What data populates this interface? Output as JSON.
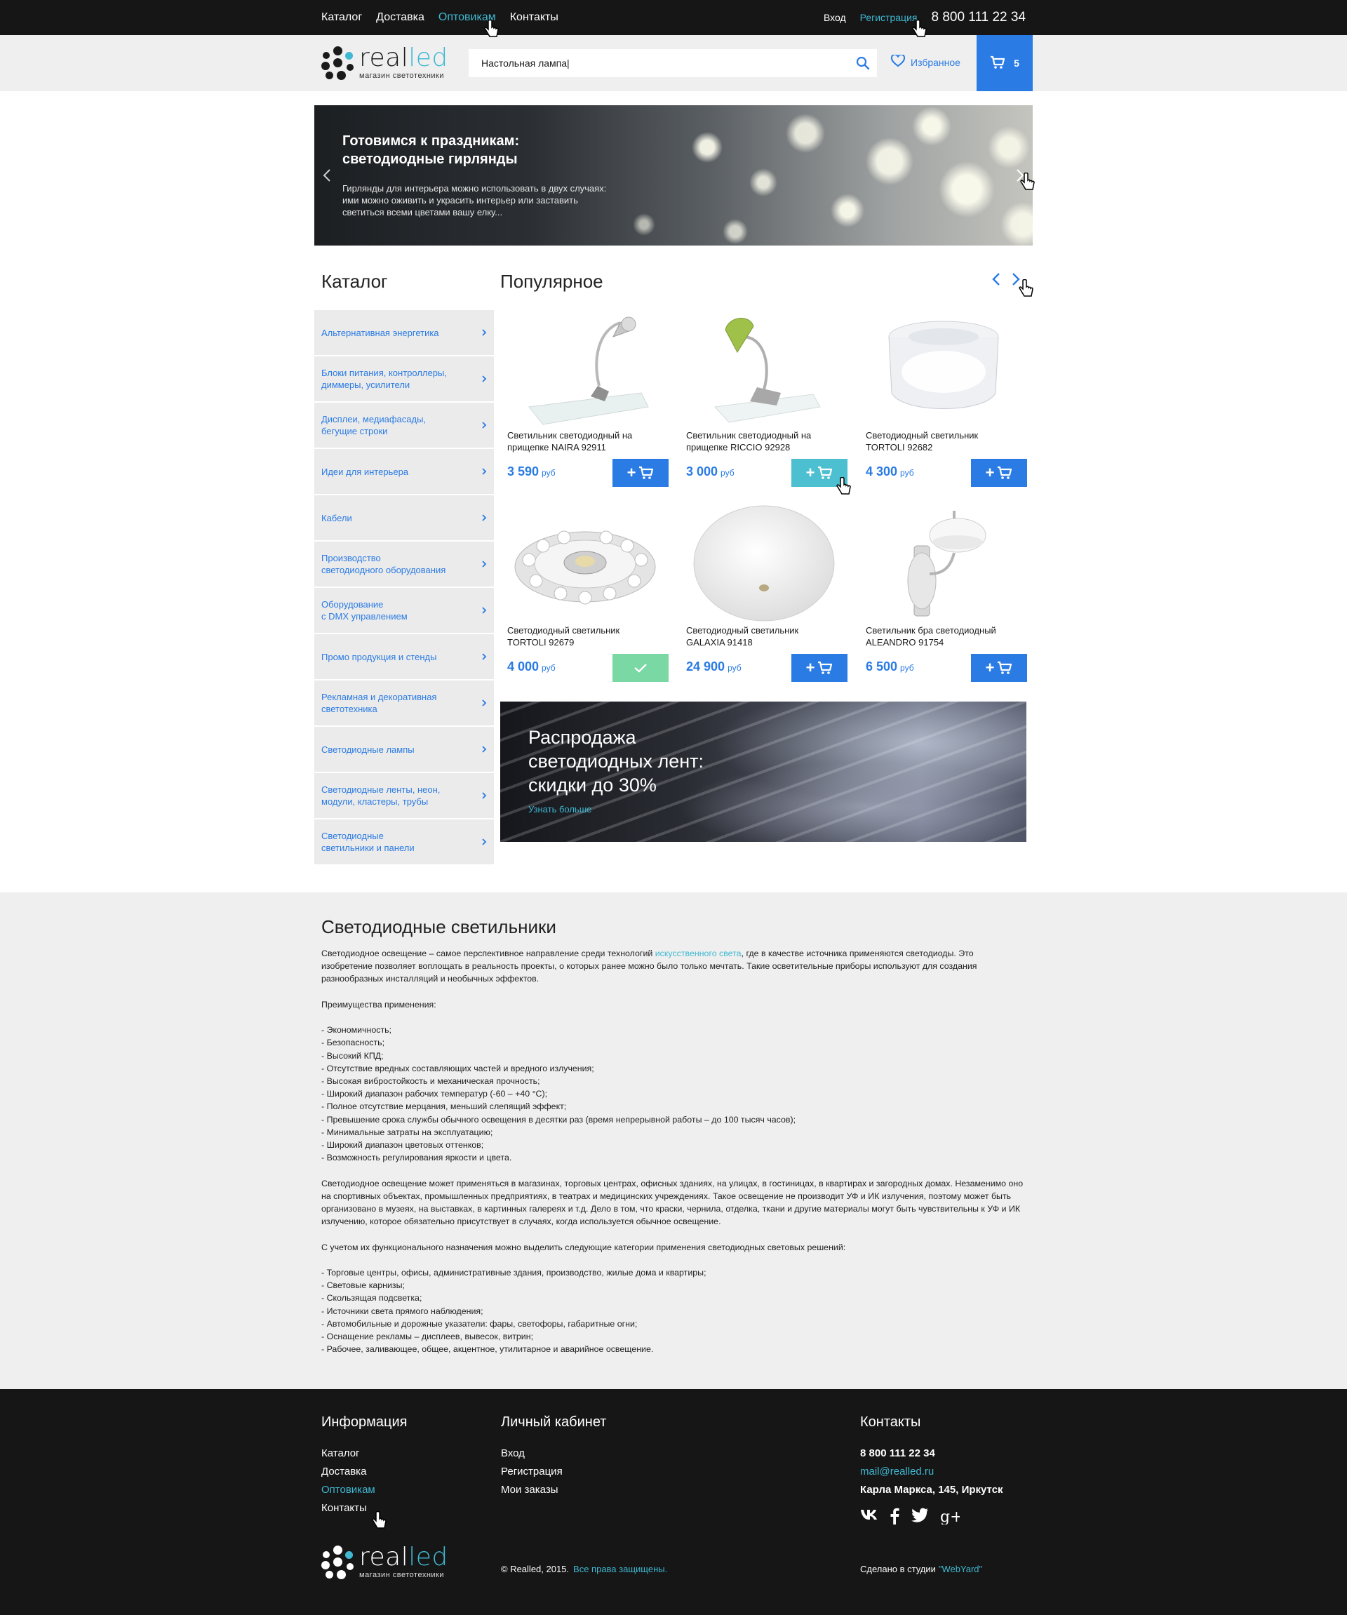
{
  "colors": {
    "accent_blue": "#2a7be4",
    "accent_cyan": "#3fb8d2",
    "dark": "#161616",
    "light_bg": "#efefef",
    "success": "#79d8a3"
  },
  "topbar": {
    "nav": [
      "Каталог",
      "Доставка",
      "Оптовикам",
      "Контакты"
    ],
    "active_nav": "Оптовикам",
    "login": "Вход",
    "register": "Регистрация",
    "phone": "8 800 111 22 34"
  },
  "header": {
    "logo": {
      "name_a": "real",
      "name_b": "led",
      "tagline": "магазин светотехники"
    },
    "search": {
      "value": "Настольная лампа|",
      "icon": "search-icon"
    },
    "favorites": {
      "label": "Избранное",
      "icon": "heart-icon"
    },
    "cart": {
      "count": "5",
      "icon": "cart-icon"
    }
  },
  "hero": {
    "title": "Готовимся к праздникам: светодиодные гирлянды",
    "text": "Гирлянды для интерьера можно использовать в двух случаях: ими можно оживить и украсить интерьер или заставить светиться всеми цветами вашу елку..."
  },
  "catalog": {
    "title": "Каталог",
    "items": [
      "Альтернативная энергетика",
      "Блоки питания, контроллеры,\nдиммеры, усилители",
      "Дисплеи, медиафасады,\nбегущие строки",
      "Идеи для интерьера",
      "Кабели",
      "Производство\nсветодиодного оборудования",
      "Оборудование\nс DMX управлением",
      "Промо продукция и стенды",
      "Рекламная и декоративная\nсветотехника",
      "Светодиодные лампы",
      "Светодиодные ленты, неон,\nмодули, кластеры, трубы",
      "Светодиодные\nсветильники и панели"
    ]
  },
  "popular": {
    "title": "Популярное",
    "products": [
      {
        "name": "Светильник светодиодный на\nприщепке NAIRA 92911",
        "price": "3 590",
        "currency": "руб",
        "state": "normal"
      },
      {
        "name": "Светильник светодиодный на\nприщепке RICCIO 92928",
        "price": "3 000",
        "currency": "руб",
        "state": "hover"
      },
      {
        "name": "Светодиодный светильник\nTORTOLI 92682",
        "price": "4 300",
        "currency": "руб",
        "state": "normal"
      },
      {
        "name": "Светодиодный светильник\nTORTOLI 92679",
        "price": "4 000",
        "currency": "руб",
        "state": "added"
      },
      {
        "name": "Светодиодный светильник\nGALAXIA 91418",
        "price": "24 900",
        "currency": "руб",
        "state": "normal"
      },
      {
        "name": "Светильник бра светодиодный\nALEANDRO 91754",
        "price": "6 500",
        "currency": "руб",
        "state": "normal"
      }
    ],
    "add_label": "+"
  },
  "sale": {
    "title": "Распродажа светодиодных лент: скидки до 30%",
    "more": "Узнать больше"
  },
  "description": {
    "title": "Светодиодные светильники",
    "intro_a": "Светодиодное освещение – самое перспективное направление среди технологий ",
    "intro_link": "искусственного света",
    "intro_b": ", где в качестве источника применяются светодиоды. Это изобретение позволяет воплощать в реальность проекты, о которых ранее можно было только мечтать. Такие осветительные приборы используют для создания разнообразных инсталляций и необычных эффектов.",
    "advantages_title": "Преимущества применения:",
    "advantages": [
      "- Экономичность;",
      "- Безопасность;",
      "- Высокий КПД;",
      "- Отсутствие вредных составляющих частей и вредного излучения;",
      "- Высокая вибростойкость и механическая прочность;",
      "- Широкий диапазон рабочих температур (-60 – +40 °С);",
      "- Полное отсутствие мерцания, меньший слепящий эффект;",
      "- Превышение срока службы обычного освещения в десятки раз (время непрерывной работы – до 100 тысяч часов);",
      "- Минимальные затраты на эксплуатацию;",
      "- Широкий диапазон цветовых оттенков;",
      "- Возможность регулирования яркости и цвета."
    ],
    "usage": "Светодиодное освещение может применяться в магазинах, торговых центрах, офисных зданиях, на улицах, в гостиницах, в квартирах и загородных домах. Незаменимо оно на спортивных объектах, промышленных предприятиях, в театрах и медицинских учреждениях. Такое освещение не производит УФ и ИК излучения, поэтому может быть организовано в музеях, на выставках, в картинных галереях и т.д. Дело в том, что краски, чернила, отделка, ткани и другие материалы могут быть чувствительны к УФ и ИК излучению, которое обязательно присутствует в случаях, когда используется обычное освещение.",
    "categories_title": "С учетом их функционального назначения можно выделить следующие категории применения светодиодных световых решений:",
    "categories": [
      "- Торговые центры, офисы, административные здания, производство, жилые дома и квартиры;",
      "- Световые карнизы;",
      "- Скользящая подсветка;",
      "- Источники света прямого наблюдения;",
      "- Автомобильные и дорожные указатели: фары, светофоры, габаритные огни;",
      "- Оснащение рекламы – дисплеев, вывесок, витрин;",
      "- Рабочее, заливающее, общее, акцентное, утилитарное и аварийное освещение."
    ]
  },
  "footer": {
    "info": {
      "title": "Информация",
      "links": [
        "Каталог",
        "Доставка",
        "Оптовикам",
        "Контакты"
      ],
      "active": "Оптовикам"
    },
    "account": {
      "title": "Личный кабинет",
      "links": [
        "Вход",
        "Регистрация",
        "Мои заказы"
      ]
    },
    "contacts": {
      "title": "Контакты",
      "phone": "8 800 111 22 34",
      "email": "mail@realled.ru",
      "address": "Карла Маркса, 145, Иркутск"
    },
    "social": [
      "vk-icon",
      "facebook-icon",
      "twitter-icon",
      "google-plus-icon"
    ],
    "copyright": "© Realled, 2015.",
    "rights": "Все права защищены.",
    "studio_label": "Сделано в студии",
    "studio_name": "\"WebYard\""
  }
}
